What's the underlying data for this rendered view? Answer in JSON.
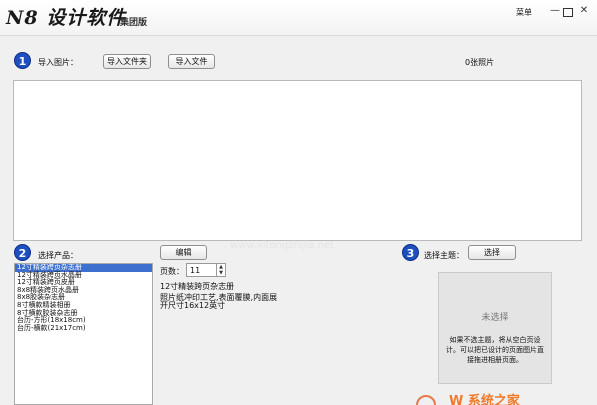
{
  "header": {
    "logo_text": "N8 设计软件",
    "edition": "集团版",
    "menu_label": "菜单"
  },
  "step1": {
    "number": "1",
    "label": "导入图片：",
    "import_folder": "导入文件夹",
    "import_file": "导入文件",
    "photo_count": "0张照片"
  },
  "step2": {
    "number": "2",
    "label": "选择产品：",
    "edit_button": "编辑",
    "products": [
      "12寸精装跨页杂志册",
      "12寸精装跨页水晶册",
      "12寸精装跨页皮册",
      "8x8精装跨页水晶册",
      "8x8胶装杂志册",
      "8寸横款精装相册",
      "8寸横款胶装杂志册",
      "台历-方形(18x18cm)",
      "台历-横款(21x17cm)"
    ],
    "pages_label": "页数：",
    "pages_value": "11",
    "product_name": "12寸精装跨页杂志册",
    "product_desc_1": "照片纸冲印工艺,表面覆膜,内面展",
    "product_desc_2": "开尺寸16x12英寸"
  },
  "step3": {
    "number": "3",
    "label": "选择主题：",
    "select_button": "选择",
    "none_selected": "未选择",
    "description": "如果不选主题，将从空白页设计。可以把已设计的页面图片直接拖进相册页面。"
  },
  "watermark": "www.xitongzhijia.net",
  "corner_logo": "W 系统之家"
}
